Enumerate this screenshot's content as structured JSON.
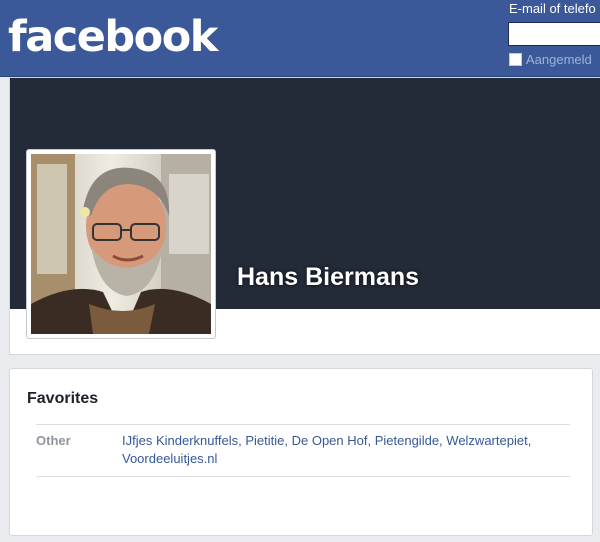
{
  "header": {
    "logo_text": "facebook",
    "login": {
      "email_label": "E-mail of telefo",
      "email_value": "",
      "remember_label": "Aangemeld"
    }
  },
  "profile": {
    "name": "Hans Biermans"
  },
  "favorites": {
    "title": "Favorites",
    "rows": [
      {
        "label": "Other",
        "items": [
          "IJfjes Kinderknuffels",
          "Pietitie",
          "De Open Hof",
          "Pietengilde",
          "Welzwartepiet",
          "Voordeeluitjes.nl"
        ],
        "separator": ", "
      }
    ]
  },
  "colors": {
    "brand_blue": "#3b5998",
    "cover_dark": "#232a38",
    "link_blue": "#365899"
  }
}
